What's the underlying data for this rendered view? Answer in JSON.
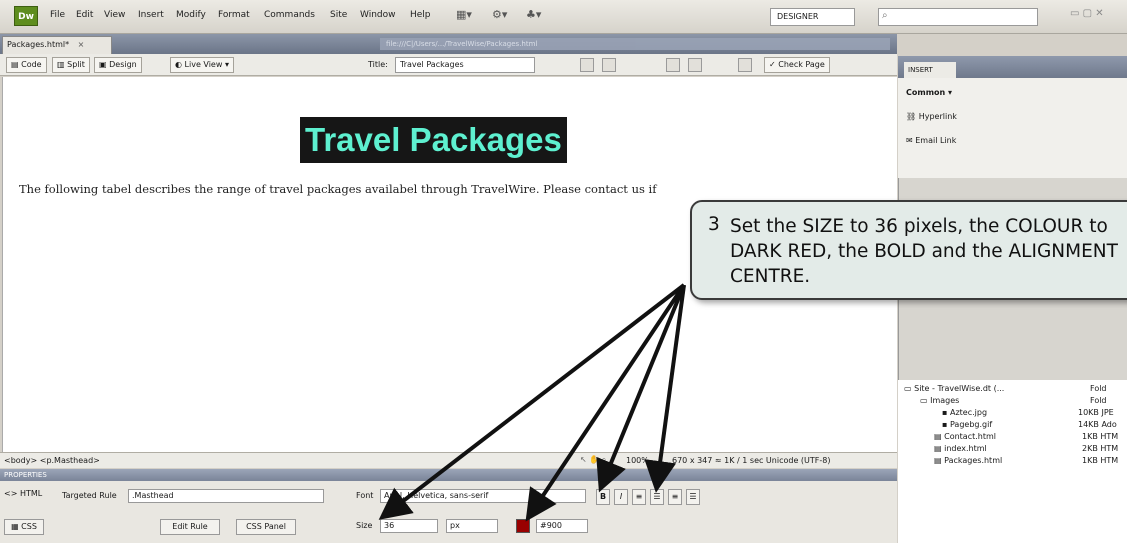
{
  "menubar": {
    "items": [
      "File",
      "Edit",
      "View",
      "Insert",
      "Modify",
      "Format",
      "Commands",
      "Site",
      "Window",
      "Help"
    ],
    "workspace": "DESIGNER"
  },
  "document": {
    "tab_label": "Packages.html*",
    "path": "file:///C|/Users/.../TravelWise/Packages.html",
    "toolbar": {
      "code": "Code",
      "split": "Split",
      "design": "Design",
      "live_view": "Live View",
      "title_label": "Title:",
      "title_value": "Travel Packages",
      "check_page": "Check Page"
    },
    "heading": "Travel Packages",
    "body_text": "The following tabel describes the range of travel packages availabel through TravelWire. Please contact us if"
  },
  "statusbar": {
    "tag_path": "<body> <p.Masthead>",
    "zoom": "100%",
    "info": "670 x 347 ≈ 1K / 1 sec  Unicode (UTF-8)"
  },
  "properties": {
    "header": "PROPERTIES",
    "html": "HTML",
    "css": "CSS",
    "targeted_rule_label": "Targeted Rule",
    "targeted_rule_value": ".Masthead",
    "edit_rule": "Edit Rule",
    "css_panel": "CSS Panel",
    "font_label": "Font",
    "font_value": "Arial, Helvetica, sans-serif",
    "size_label": "Size",
    "size_value": "36",
    "unit_value": "px",
    "color_value": "#900",
    "bold": "B",
    "italic": "I"
  },
  "insert_panel": {
    "tab": "INSERT",
    "category": "Common",
    "items": [
      "Hyperlink",
      "Email Link"
    ]
  },
  "files_panel": {
    "site": "Site - TravelWise.dt (...",
    "rows": [
      {
        "name": "Images",
        "info": "Fold"
      },
      {
        "name": "Aztec.jpg",
        "info": "10KB JPE"
      },
      {
        "name": "Pagebg.gif",
        "info": "14KB Ado"
      },
      {
        "name": "Contact.html",
        "info": "1KB HTM"
      },
      {
        "name": "index.html",
        "info": "2KB HTM"
      },
      {
        "name": "Packages.html",
        "info": "1KB HTM"
      }
    ],
    "site_info": "Fold"
  },
  "callout": {
    "number": "3",
    "text": "Set the SIZE to 36 pixels, the COLOUR to DARK RED, the BOLD and the ALIGNMENT CENTRE."
  },
  "colors": {
    "heading_bg": "#161616",
    "heading_fg": "#5ef0d0",
    "swatch": "#990000",
    "callout_bg": "#e3ebe8"
  }
}
